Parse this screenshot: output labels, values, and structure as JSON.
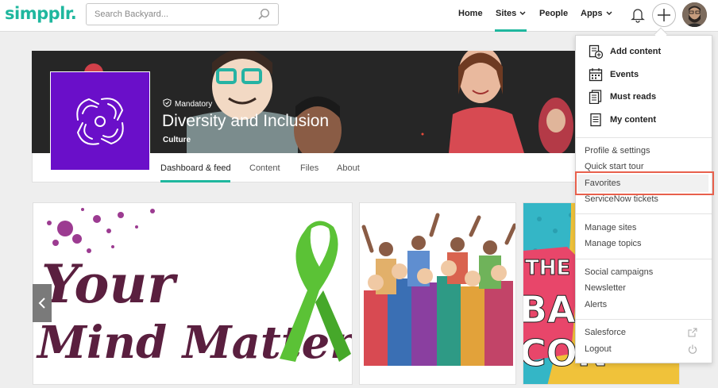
{
  "header": {
    "logo": "simpplr.",
    "search_placeholder": "Search Backyard...",
    "nav": {
      "home": "Home",
      "sites": "Sites",
      "people": "People",
      "apps": "Apps"
    }
  },
  "site": {
    "mandatory": "Mandatory",
    "title": "Diversity and Inclusion",
    "category": "Culture",
    "tabs": [
      "Dashboard & feed",
      "Content",
      "Files",
      "About"
    ]
  },
  "menu": {
    "top_items": [
      "Add content",
      "Events",
      "Must reads",
      "My content"
    ],
    "group1": [
      "Profile & settings",
      "Quick start tour",
      "Favorites",
      "ServiceNow tickets"
    ],
    "group2": [
      "Manage sites",
      "Manage topics"
    ],
    "group3": [
      "Social campaigns",
      "Newsletter",
      "Alerts"
    ],
    "group4": [
      "Salesforce",
      "Logout"
    ]
  },
  "colors": {
    "brand": "#1fb79e",
    "site_logo": "#6a0fc9",
    "highlight": "#e8604c",
    "ribbon": "#5bc236",
    "text_purple": "#5a1f3f"
  },
  "icons": [
    "search-icon",
    "bell-icon",
    "plus-icon",
    "shield-check-icon",
    "add-content-icon",
    "calendar-icon",
    "must-reads-icon",
    "document-icon",
    "external-link-icon",
    "power-icon",
    "chevron-left-icon"
  ]
}
